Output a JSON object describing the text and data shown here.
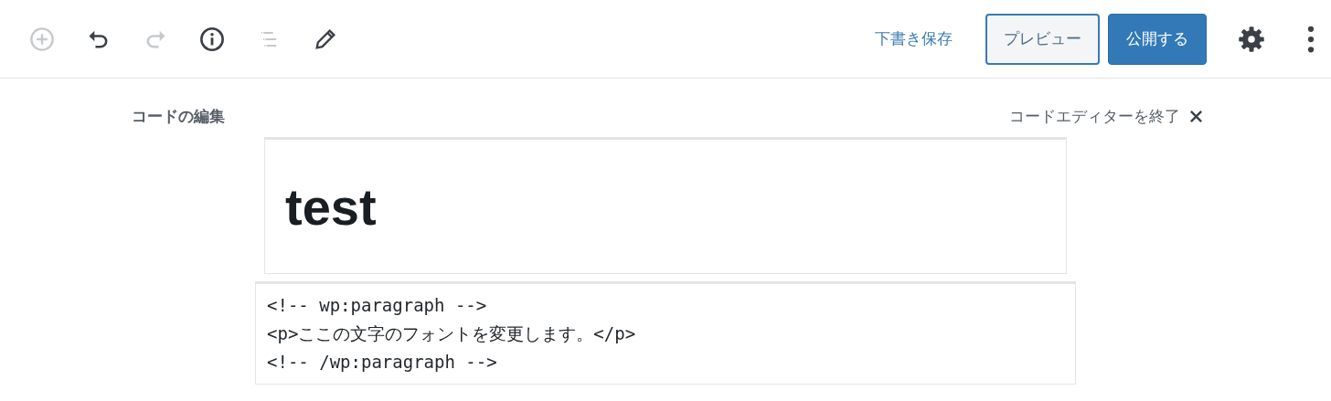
{
  "toolbar": {
    "tools": [
      {
        "kind": "add",
        "disabled": true
      },
      {
        "kind": "undo",
        "disabled": false
      },
      {
        "kind": "redo",
        "disabled": true
      },
      {
        "kind": "info",
        "disabled": false
      },
      {
        "kind": "outline",
        "disabled": true
      },
      {
        "kind": "edit",
        "disabled": false
      }
    ],
    "save_draft": "下書き保存",
    "preview": "プレビュー",
    "publish": "公開する"
  },
  "code_editor": {
    "heading": "コードの編集",
    "exit": "コードエディターを終了",
    "title": "test",
    "code_lines": [
      "<!-- wp:paragraph -->",
      "<p>ここの文字のフォントを変更します。</p>",
      "<!-- /wp:paragraph -->"
    ]
  }
}
